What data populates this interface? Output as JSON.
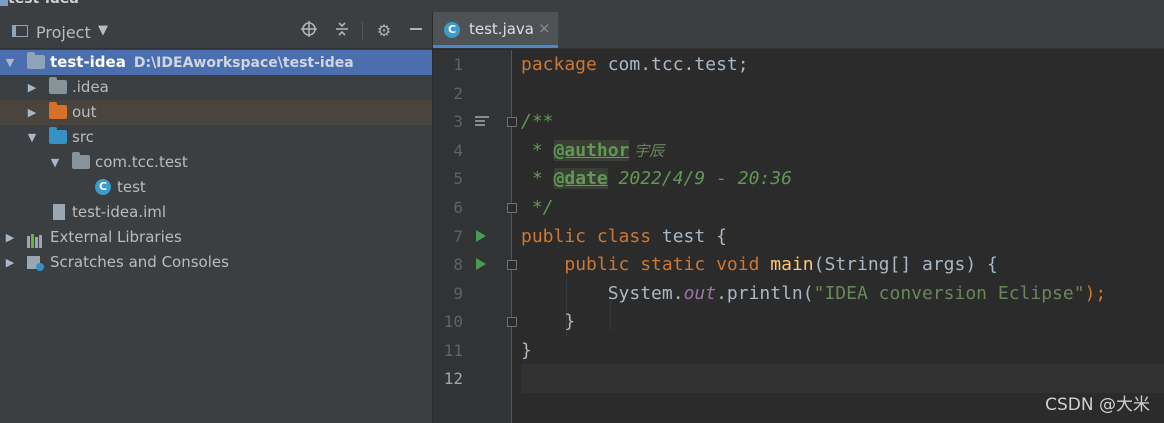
{
  "window": {
    "title": "test-idea"
  },
  "project_panel": {
    "title": "Project",
    "icons": [
      "locate-icon",
      "collapse-icon",
      "gear-icon",
      "minimize-icon"
    ],
    "tree": [
      {
        "label": "test-idea",
        "path": "D:\\IDEAworkspace\\test-idea",
        "icon": "module-folder-icon",
        "expanded": true,
        "selected": true
      },
      {
        "label": ".idea",
        "icon": "folder-icon",
        "expanded": false
      },
      {
        "label": "out",
        "icon": "excluded-folder-icon",
        "expanded": false
      },
      {
        "label": "src",
        "icon": "source-folder-icon",
        "expanded": true
      },
      {
        "label": "com.tcc.test",
        "icon": "package-icon",
        "expanded": true
      },
      {
        "label": "test",
        "icon": "java-class-icon"
      },
      {
        "label": "test-idea.iml",
        "icon": "iml-file-icon"
      },
      {
        "label": "External Libraries",
        "icon": "libraries-icon",
        "expanded": false
      },
      {
        "label": "Scratches and Consoles",
        "icon": "scratches-icon",
        "expanded": false
      }
    ]
  },
  "editor": {
    "tab": {
      "label": "test.java",
      "close": "×"
    },
    "line_numbers": [
      "1",
      "2",
      "3",
      "4",
      "5",
      "6",
      "7",
      "8",
      "9",
      "10",
      "11",
      "12"
    ],
    "current_line": "12",
    "code": {
      "l1_kw": "package",
      "l1_rest": " com.tcc.test;",
      "l3": "/**",
      "l4_star": " * ",
      "l4_tag": "@author",
      "l4_val": " 宇辰",
      "l5_star": " * ",
      "l5_tag": "@date",
      "l5_val": " 2022/4/9 - 20:36",
      "l6": " */",
      "l7_kw": "public class",
      "l7_rest": " test {",
      "l8_indent": "    ",
      "l8_kw": "public static void",
      "l8_sp": " ",
      "l8_fn": "main",
      "l8_rest": "(String[] args) {",
      "l9_indent": "        ",
      "l9_a": "System.",
      "l9_field": "out",
      "l9_b": ".println(",
      "l9_str": "\"IDEA conversion Eclipse\"",
      "l9_c": ");",
      "l10": "    }",
      "l11": "}"
    }
  },
  "watermark": "CSDN @大米"
}
